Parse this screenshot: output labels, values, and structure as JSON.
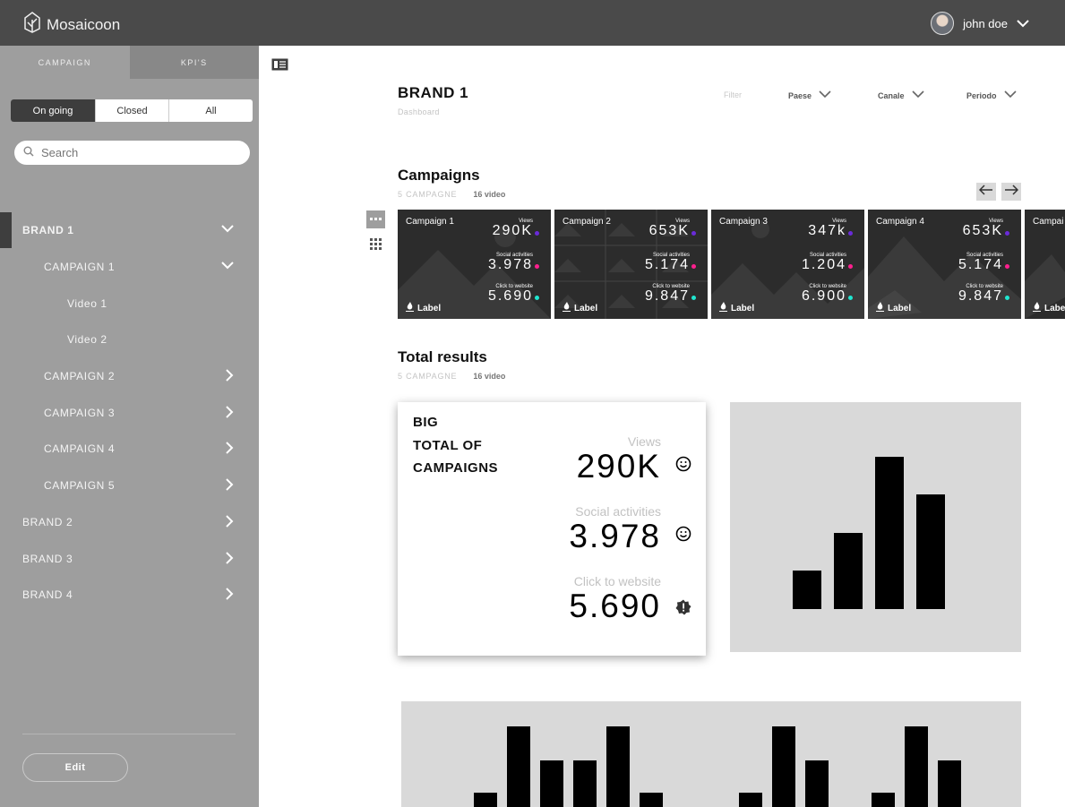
{
  "header": {
    "app_name": "Mosaicoon",
    "user_name": "john doe"
  },
  "sidebar": {
    "tabs": [
      {
        "label": "CAMPAIGN",
        "active": true
      },
      {
        "label": "KPI'S",
        "active": false
      }
    ],
    "status_filter": [
      {
        "label": "On going",
        "selected": true
      },
      {
        "label": "Closed",
        "selected": false
      },
      {
        "label": "All",
        "selected": false
      }
    ],
    "search_placeholder": "Search",
    "tree": [
      {
        "label": "BRAND 1",
        "level": 0,
        "expanded": true,
        "selected": true
      },
      {
        "label": "CAMPAIGN 1",
        "level": 1,
        "expanded": true
      },
      {
        "label": "Video 1",
        "level": 2
      },
      {
        "label": "Video 2",
        "level": 2
      },
      {
        "label": "CAMPAIGN 2",
        "level": 1,
        "expanded": false
      },
      {
        "label": "CAMPAIGN 3",
        "level": 1,
        "expanded": false
      },
      {
        "label": "CAMPAIGN 4",
        "level": 1,
        "expanded": false
      },
      {
        "label": "CAMPAIGN 5",
        "level": 1,
        "expanded": false
      },
      {
        "label": "BRAND 2",
        "level": 0,
        "expanded": false
      },
      {
        "label": "BRAND 3",
        "level": 0,
        "expanded": false
      },
      {
        "label": "BRAND 4",
        "level": 0,
        "expanded": false
      }
    ],
    "edit_label": "Edit"
  },
  "main": {
    "title": "BRAND 1",
    "subtitle": "Dashboard",
    "filters": {
      "label": "Filter",
      "paese": "Paese",
      "canale": "Canale",
      "periodo": "Periodo"
    },
    "campaigns": {
      "title": "Campaigns",
      "count_label": "5 CAMPAGNE",
      "video_label": "16 video",
      "cards": [
        {
          "name": "Campaign 1",
          "views": "290K",
          "social": "3.978",
          "click": "5.690",
          "label": "Label"
        },
        {
          "name": "Campaign 2",
          "views": "653K",
          "social": "5.174",
          "click": "9.847",
          "label": "Label"
        },
        {
          "name": "Campaign 3",
          "views": "347k",
          "social": "1.204",
          "click": "6.900",
          "label": "Label"
        },
        {
          "name": "Campaign 4",
          "views": "653K",
          "social": "5.174",
          "click": "9.847",
          "label": "Label"
        },
        {
          "name": "Campai",
          "views": "",
          "social": "",
          "click": "",
          "label": "Labe"
        }
      ],
      "stat_labels": {
        "views": "Views",
        "social": "Social activities",
        "click": "Click to website"
      }
    },
    "total": {
      "title": "Total results",
      "count_label": "5 CAMPAGNE",
      "video_label": "16 video",
      "big_title": [
        "BIG",
        "TOTAL OF",
        "CAMPAIGNS"
      ],
      "views_label": "Views",
      "views_value": "290K",
      "social_label": "Social activities",
      "social_value": "3.978",
      "click_label": "Click to website",
      "click_value": "5.690"
    }
  },
  "chart_data": [
    {
      "type": "bar",
      "values": [
        25,
        50,
        100,
        75
      ]
    },
    {
      "type": "bar",
      "values": [
        10,
        55,
        32,
        32,
        55,
        10,
        0,
        0,
        10,
        55,
        32,
        0,
        10,
        55,
        32
      ]
    }
  ],
  "colors": {
    "views_dot": "#6a2bd9",
    "social_dot": "#ff1f8e",
    "click_dot": "#20e6d0",
    "topbar": "#4a4a4a",
    "sidebar": "#9e9e9e"
  }
}
